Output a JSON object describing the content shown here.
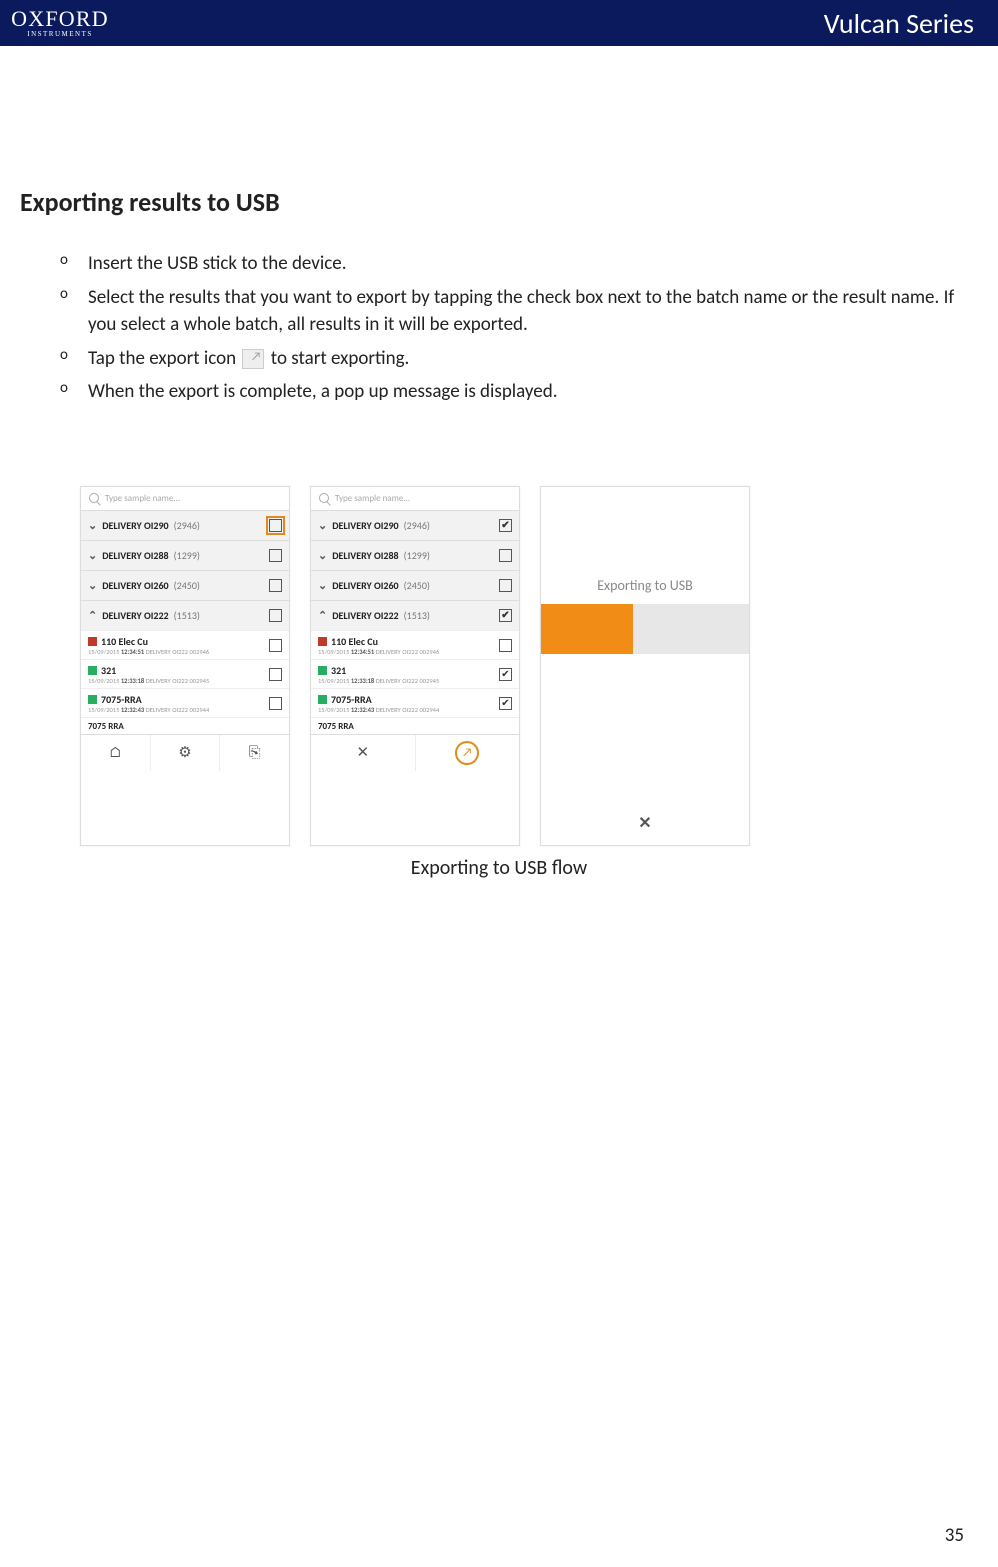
{
  "header": {
    "logo_main": "OXFORD",
    "logo_sub": "INSTRUMENTS",
    "series": "Vulcan Series"
  },
  "heading": "Exporting results to USB",
  "steps": {
    "s1": "Insert the USB stick to the device.",
    "s2": "Select the results that you want to export by tapping the check box next to the batch name or the result name. If you select a whole batch, all results in it will be exported.",
    "s3a": "Tap the export icon",
    "s3b": " to start exporting.",
    "s4": "When the export is complete, a pop up message is displayed."
  },
  "search_placeholder": "Type sample name...",
  "batches": [
    {
      "name": "DELIVERY OI290",
      "count": "(2946)",
      "chev": "⌄"
    },
    {
      "name": "DELIVERY OI288",
      "count": "(1299)",
      "chev": "⌄"
    },
    {
      "name": "DELIVERY OI260",
      "count": "(2450)",
      "chev": "⌄"
    },
    {
      "name": "DELIVERY OI222",
      "count": "(1513)",
      "chev": "⌃"
    }
  ],
  "items": [
    {
      "title": "110 Elec Cu",
      "color": "red",
      "date": "15/09/2015",
      "time": "12:34:51",
      "ref": "DELIVERY OI222 002946"
    },
    {
      "title": "321",
      "color": "green",
      "date": "15/09/2015",
      "time": "12:33:18",
      "ref": "DELIVERY OI222 002945"
    },
    {
      "title": "7075-RRA",
      "color": "green",
      "date": "15/09/2015",
      "time": "12:32:43",
      "ref": "DELIVERY OI222 002944"
    }
  ],
  "peek_item": "7075 RRA",
  "screen2_checks": {
    "b0": true,
    "b1": false,
    "b2": false,
    "b3": true,
    "i0": false,
    "i1": true,
    "i2": true
  },
  "export_label": "Exporting to USB",
  "caption": "Exporting to USB flow",
  "page": "35",
  "icons": {
    "home": "⌂",
    "gear": "⚙",
    "cal": "⎘",
    "close": "✕",
    "export": "↗"
  }
}
